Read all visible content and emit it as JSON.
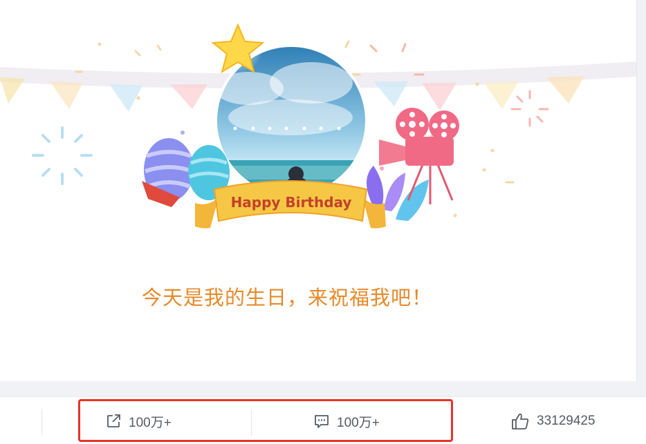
{
  "post": {
    "banner_text": "Happy Birthday",
    "message": "今天是我的生日，来祝福我吧！"
  },
  "actions": {
    "share_count": "100万+",
    "comment_count": "100万+",
    "like_count": "33129425"
  },
  "icons": {
    "share": "share-icon",
    "comment": "comment-icon",
    "like": "thumbs-up-icon"
  },
  "colors": {
    "message_text": "#e58a2a",
    "highlight_border": "#e8312a",
    "banner_ribbon": "#f6c744",
    "banner_text": "#c2412b"
  }
}
